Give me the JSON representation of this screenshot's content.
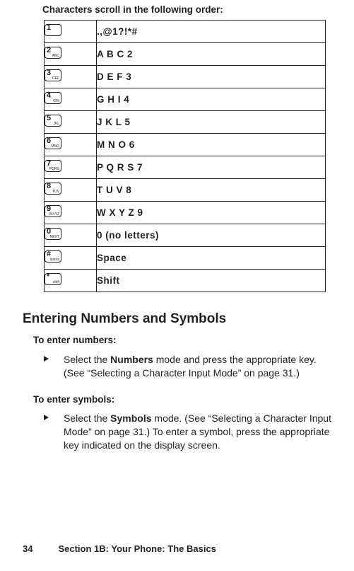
{
  "title": "Characters scroll in the following order:",
  "keys": [
    {
      "key_main": "1",
      "key_sub": "",
      "chars": ".,@1?!*#"
    },
    {
      "key_main": "2",
      "key_sub": "ABC",
      "chars": "A B C 2"
    },
    {
      "key_main": "3",
      "key_sub": "DEF",
      "chars": "D E F 3"
    },
    {
      "key_main": "4",
      "key_sub": "GHI",
      "chars": "G H I 4"
    },
    {
      "key_main": "5",
      "key_sub": "JKL",
      "chars": "J K L 5"
    },
    {
      "key_main": "6",
      "key_sub": "MNO",
      "chars": "M N O 6"
    },
    {
      "key_main": "7",
      "key_sub": "PQRS",
      "chars": "P Q R S 7"
    },
    {
      "key_main": "8",
      "key_sub": "TUV",
      "chars": "T U V 8"
    },
    {
      "key_main": "9",
      "key_sub": "WXYZ",
      "chars": "W X Y Z 9"
    },
    {
      "key_main": "0",
      "key_sub": "NEXT",
      "chars": "0 (no letters)"
    },
    {
      "key_main": "#",
      "key_sub": "space",
      "chars": "Space"
    },
    {
      "key_main": "*",
      "key_sub": "shift",
      "chars": "Shift"
    }
  ],
  "heading2": "Entering Numbers and Symbols",
  "subhead_numbers": "To enter numbers:",
  "numbers_text_pre": "Select the ",
  "numbers_bold": "Numbers",
  "numbers_text_post": " mode and press the appropriate key. (See “Selecting a Character Input Mode” on page 31.)",
  "subhead_symbols": "To enter symbols:",
  "symbols_text_pre": "Select the ",
  "symbols_bold": "Symbols",
  "symbols_text_post": " mode. (See “Selecting a Character Input Mode” on page 31.) To enter a symbol, press the appropriate key indicated on the display screen.",
  "footer_page": "34",
  "footer_section": "Section 1B: Your Phone: The Basics"
}
